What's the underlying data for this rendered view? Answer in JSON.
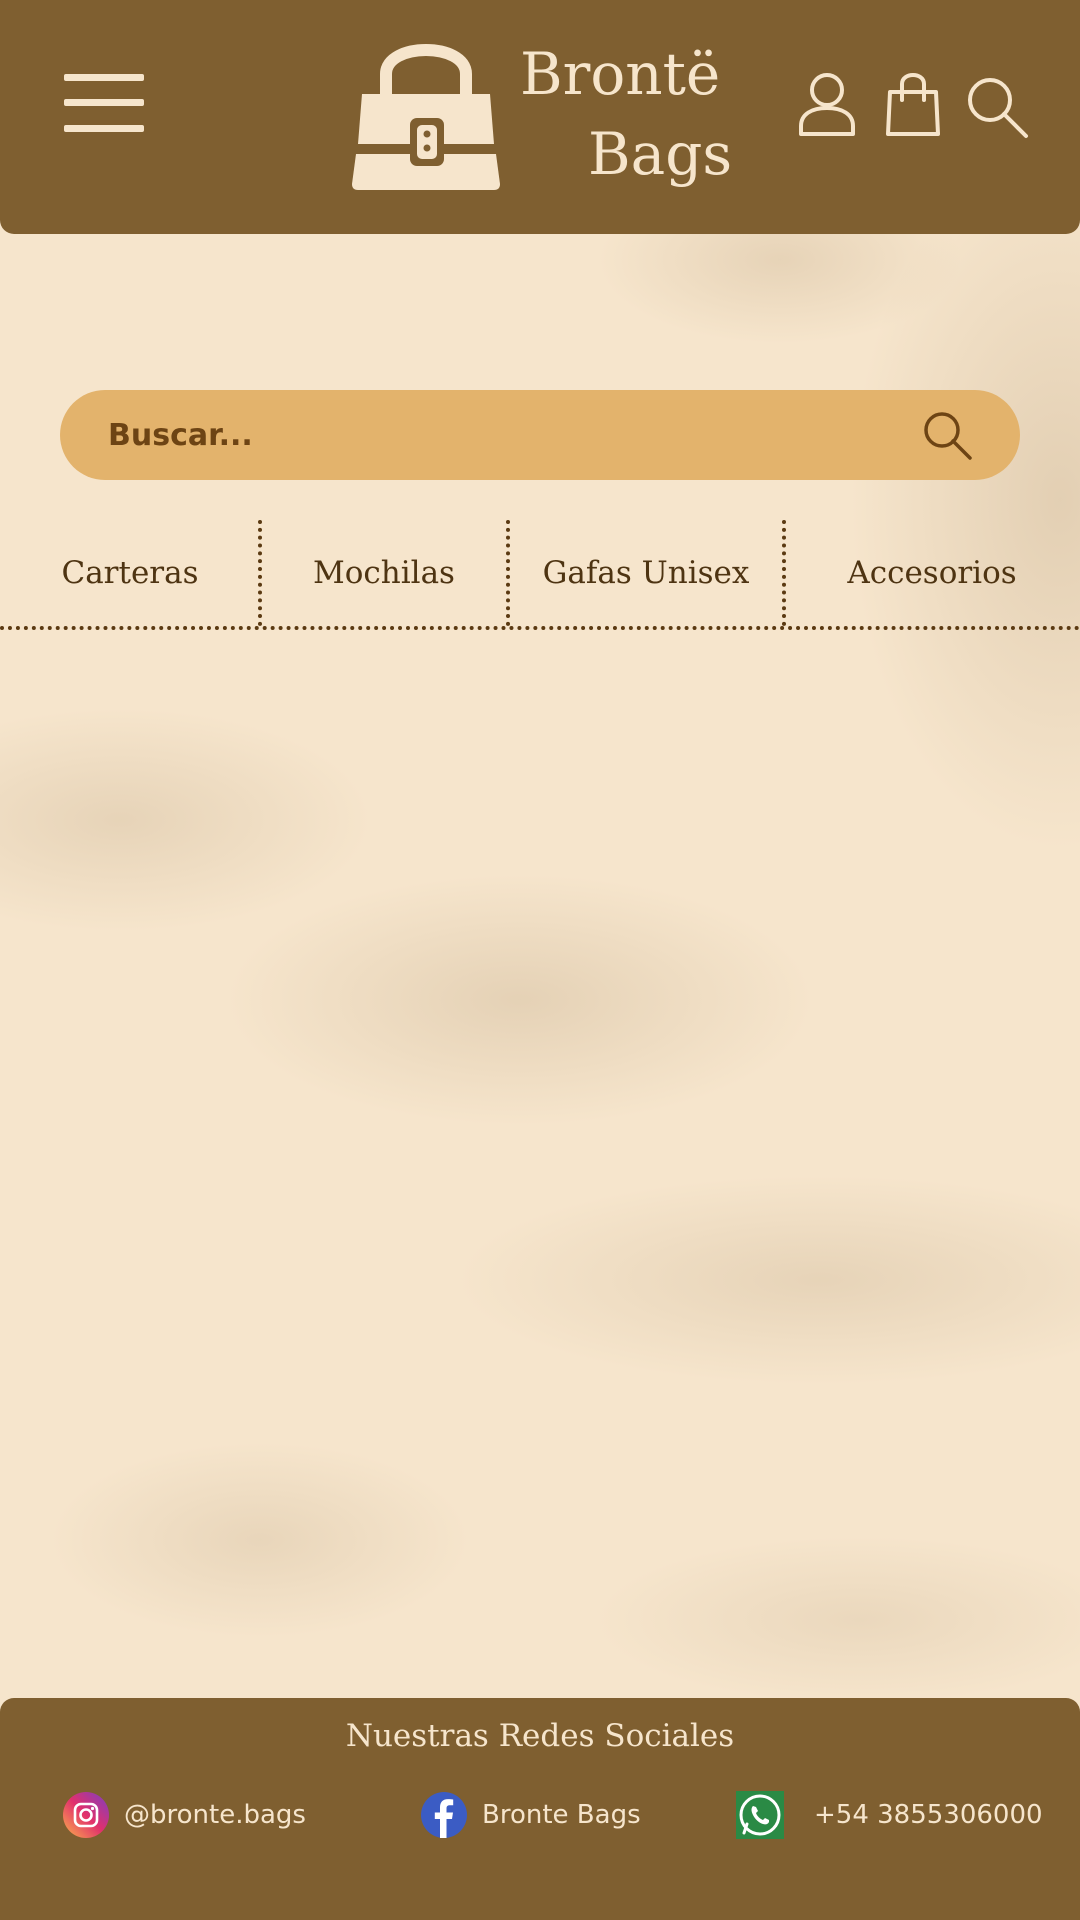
{
  "header": {
    "brand_line1": "Brontë",
    "brand_line2": "Bags",
    "icons": [
      "menu-icon",
      "handbag-logo-icon",
      "user-icon",
      "shopping-bag-icon",
      "search-icon"
    ]
  },
  "search": {
    "placeholder": "Buscar..."
  },
  "categories": [
    {
      "label": "Carteras"
    },
    {
      "label": "Mochilas"
    },
    {
      "label": "Gafas Unisex"
    },
    {
      "label": "Accesorios"
    }
  ],
  "footer": {
    "title": "Nuestras Redes Sociales",
    "instagram": "@bronte.bags",
    "facebook": "Bronte Bags",
    "whatsapp": "+54 3855306000"
  },
  "colors": {
    "header_bg": "#7f5f30",
    "page_bg": "#f6e5cc",
    "search_bg": "#e3b36c",
    "text_dark": "#4e3412"
  }
}
